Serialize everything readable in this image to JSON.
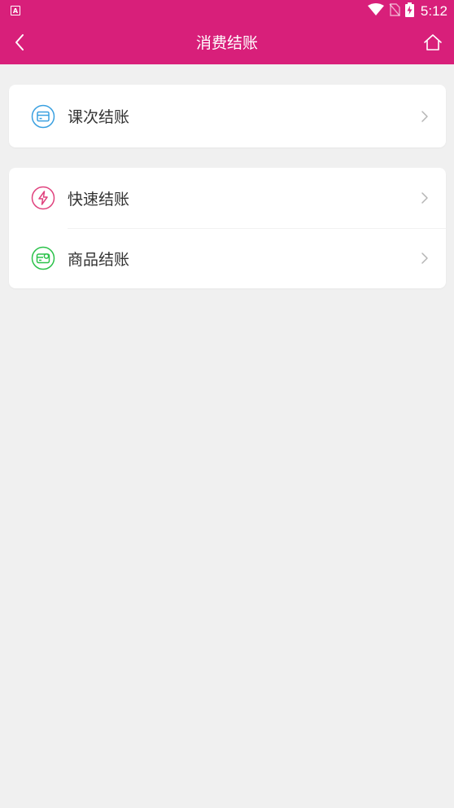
{
  "status_bar": {
    "time": "5:12",
    "notification_icon": "a-badge-icon",
    "icons": [
      "wifi-icon",
      "no-sim-icon",
      "battery-charging-icon"
    ]
  },
  "appbar": {
    "title": "消费结账",
    "back_icon": "back-icon",
    "home_icon": "home-icon",
    "background": "#d81f7a"
  },
  "groups": [
    {
      "items": [
        {
          "label": "课次结账",
          "icon": "card-icon",
          "color": "#3aa0e0"
        }
      ]
    },
    {
      "items": [
        {
          "label": "快速结账",
          "icon": "lightning-icon",
          "color": "#e0427e"
        },
        {
          "label": "商品结账",
          "icon": "product-card-icon",
          "color": "#2bc24a"
        }
      ]
    }
  ]
}
